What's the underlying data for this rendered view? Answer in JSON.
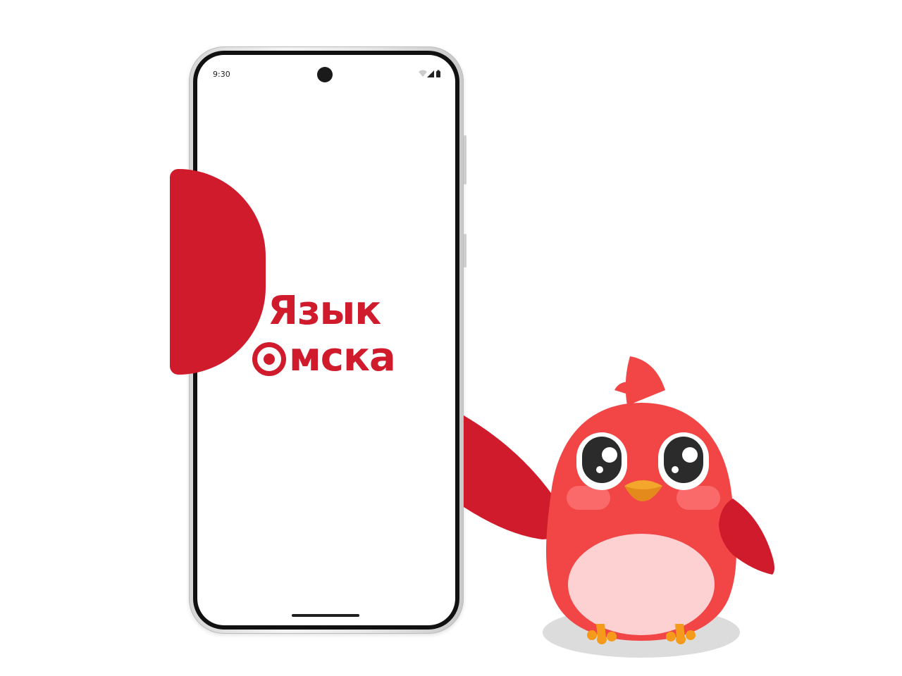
{
  "device": {
    "status_time": "9:30",
    "icons": [
      "wifi-icon",
      "cellular-signal-icon",
      "battery-icon"
    ]
  },
  "logo": {
    "line1": "Язык",
    "line2_rest": "мска",
    "o_glyph_name": "target-o-icon"
  },
  "colors": {
    "brand_red": "#cf1b2c",
    "bird_body": "#f24545",
    "bird_belly": "#fdd1d1",
    "beak": "#f4a52c",
    "feet": "#f59a1b",
    "shadow": "#dcdcdc"
  },
  "mascot": {
    "name": "bird-mascot-icon"
  }
}
